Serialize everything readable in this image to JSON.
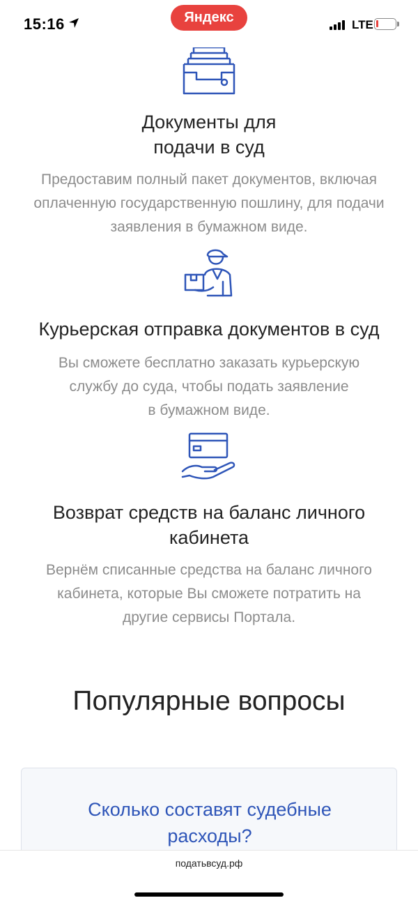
{
  "status_bar": {
    "time": "15:16",
    "app_pill": "Яндекс",
    "network": "LTE",
    "accent_color": "#e8423e"
  },
  "features": [
    {
      "icon": "document-tray-icon",
      "title_line1": "Документы для",
      "title_line2": "подачи в суд",
      "text_line1": "Предоставим полный пакет документов, включая",
      "text_line2": "оплаченную государственную пошлину, для подачи",
      "text_line3": "заявления в бумажном виде."
    },
    {
      "icon": "courier-icon",
      "title_line1": "Курьерская отправка документов в суд",
      "text_line1": "Вы сможете бесплатно заказать курьерскую",
      "text_line2": "службу до суда, чтобы подать заявление",
      "text_line3": "в бумажном виде."
    },
    {
      "icon": "card-in-hand-icon",
      "title_line1": "Возврат средств на баланс личного",
      "title_line2": "кабинета",
      "text_line1": "Вернём списанные средства на баланс личного",
      "text_line2": "кабинета, которые Вы сможете потратить на",
      "text_line3": "другие сервисы Портала."
    }
  ],
  "faq": {
    "heading": "Популярные вопросы",
    "question_line1": "Сколько составят судебные",
    "question_line2": "расходы?"
  },
  "browser": {
    "url": "податьвсуд.рф"
  },
  "colors": {
    "icon_blue": "#2e55b8",
    "link_blue": "#2e55b8",
    "muted_text": "#8c8c8c"
  }
}
